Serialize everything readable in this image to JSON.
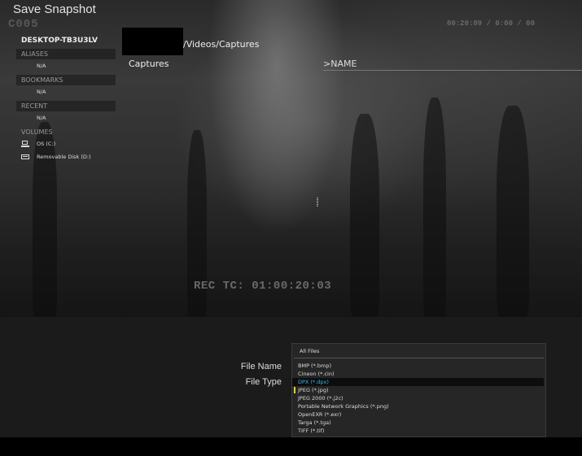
{
  "window": {
    "title": "Save Snapshot"
  },
  "overlay": {
    "clip_tag": "C005",
    "top_timecode": "00:20:09 / 0:00 / 00",
    "rec_tc": "REC TC: 01:00:20:03"
  },
  "sidebar": {
    "host": "DESKTOP-TB3U3LV",
    "sections": {
      "aliases": {
        "label": "ALIASES",
        "item": "N/A"
      },
      "bookmarks": {
        "label": "BOOKMARKS",
        "item": "N/A"
      },
      "recent": {
        "label": "RECENT",
        "item": "N/A"
      },
      "volumes": {
        "label": "VOLUMES",
        "items": [
          {
            "label": "OS (C:)",
            "icon": "computer-drive-icon"
          },
          {
            "label": "Removable Disk (D:)",
            "icon": "removable-disk-icon"
          }
        ]
      }
    }
  },
  "browser": {
    "path": "/Videos/Captures",
    "items": [
      "Captures"
    ],
    "column_header": ">NAME"
  },
  "form": {
    "file_name_label": "File Name",
    "file_type_label": "File Type"
  },
  "file_type_dropdown": {
    "header": "All Files",
    "options": [
      "BMP (*.bmp)",
      "Cineon (*.cin)",
      "DPX (*.dpx)",
      "JPEG (*.jpg)",
      "JPEG 2000 (*.j2c)",
      "Portable Network Graphics (*.png)",
      "OpenEXR (*.exr)",
      "Targa (*.tga)",
      "TIFF (*.tif)"
    ],
    "selected": "DPX (*.dpx)",
    "current": "JPEG (*.jpg)"
  },
  "colors": {
    "selection_text": "#36b7e8",
    "current_marker": "#e6d21a"
  }
}
